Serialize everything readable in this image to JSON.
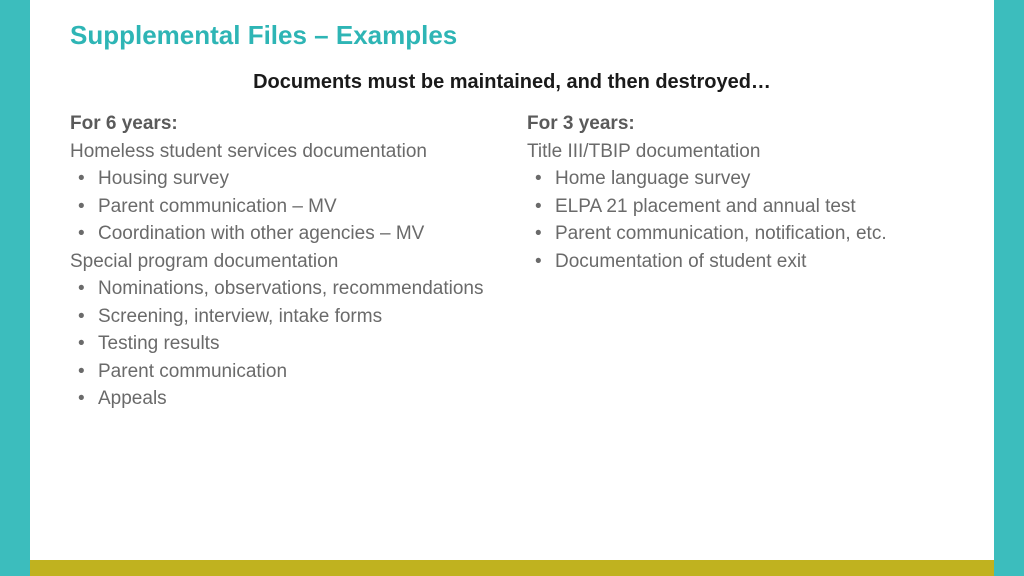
{
  "title": "Supplemental Files – Examples",
  "subtitle": "Documents must be maintained, and then destroyed…",
  "left": {
    "header": "For 6 years:",
    "group1_heading": "Homeless student services documentation",
    "group1_items": [
      "Housing survey",
      "Parent communication – MV",
      "Coordination with other agencies – MV"
    ],
    "group2_heading": "Special program documentation",
    "group2_items": [
      "Nominations, observations, recommendations",
      "Screening, interview, intake forms",
      "Testing results",
      "Parent communication",
      "Appeals"
    ]
  },
  "right": {
    "header": "For 3 years:",
    "group1_heading": "Title III/TBIP documentation",
    "group1_items": [
      "Home language survey",
      "ELPA 21 placement and annual test",
      "Parent communication, notification, etc.",
      "Documentation of student exit"
    ]
  }
}
